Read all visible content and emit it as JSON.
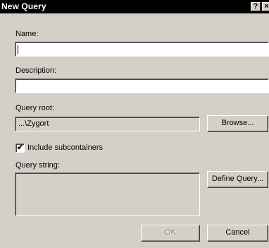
{
  "window": {
    "title": "New Query",
    "help_label": "?",
    "close_label": "×"
  },
  "form": {
    "name_label": "Name:",
    "name_value": "",
    "description_label": "Description:",
    "description_value": "",
    "query_root_label": "Query root:",
    "query_root_value": "...\\Zygort",
    "browse_label": "Browse...",
    "include_subcontainers_label": "Include subcontainers",
    "include_subcontainers_checked": true,
    "query_string_label": "Query string:",
    "query_string_value": "",
    "define_query_label": "Define Query..."
  },
  "footer": {
    "ok_label": "OK",
    "ok_enabled": false,
    "cancel_label": "Cancel"
  },
  "colors": {
    "titlebar": "#000000",
    "face": "#d4d0c8"
  }
}
